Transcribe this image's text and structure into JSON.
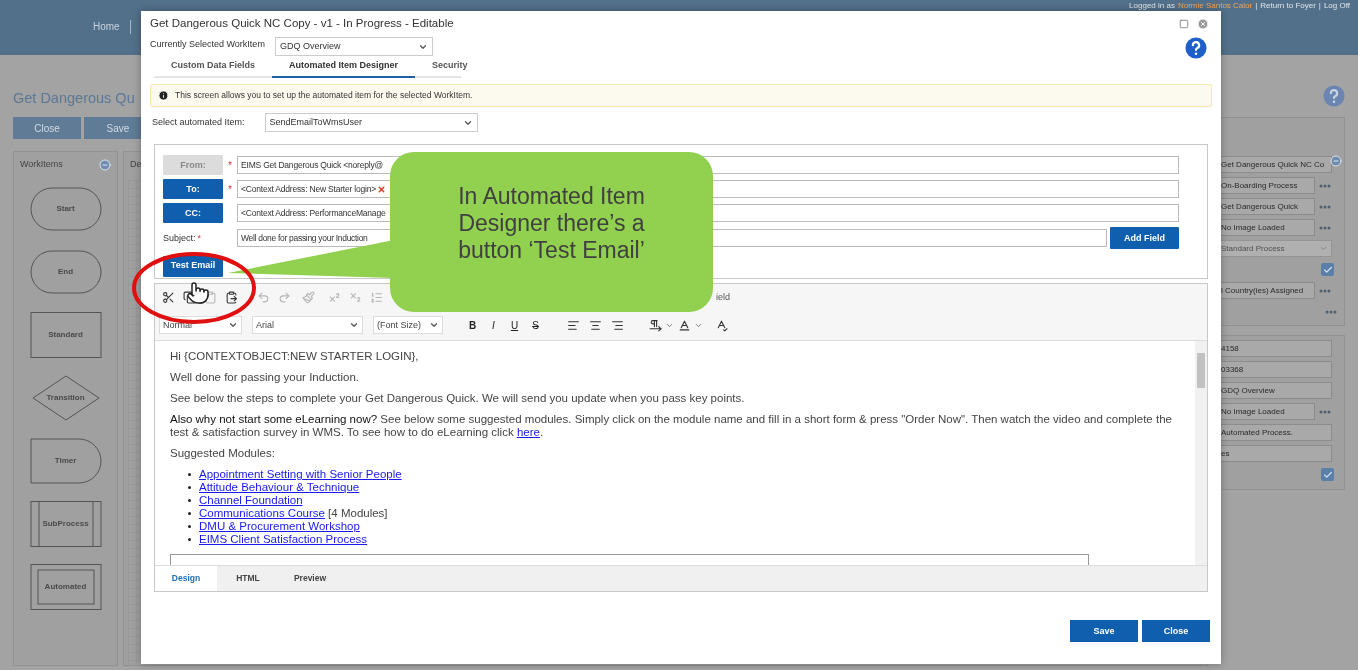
{
  "app_header": {
    "nav": [
      "Home"
    ],
    "user": {
      "prefix": "Logged in as",
      "name": "Normie Santos Calor",
      "separator": "|",
      "links": [
        "Return to Foyer",
        "Log Off"
      ]
    }
  },
  "page": {
    "title": "Get Dangerous Qu",
    "buttons": [
      "Close",
      "Save"
    ],
    "workitems_panel": {
      "title": "WorkItems",
      "items": [
        {
          "kind": "start",
          "label": "Start"
        },
        {
          "kind": "end",
          "label": "End"
        },
        {
          "kind": "standard",
          "label": "Standard"
        },
        {
          "kind": "transition",
          "label": "Transition"
        },
        {
          "kind": "timer",
          "label": "Timer"
        },
        {
          "kind": "subprocess",
          "label": "SubProcess"
        },
        {
          "kind": "automated",
          "label": "Automated"
        }
      ]
    },
    "designer_panel": {
      "title": "De"
    }
  },
  "properties": {
    "panels": [
      {
        "rows": [
          {
            "kind": "field",
            "value": "Get Dangerous Quick NC Co"
          },
          {
            "kind": "menu",
            "value": "On-Boarding Process"
          },
          {
            "kind": "menu",
            "value": "Get Dangerous Quick"
          },
          {
            "kind": "menu",
            "value": "No Image Loaded"
          },
          {
            "kind": "select",
            "value": "Standard Process"
          },
          {
            "kind": "checkbox",
            "checked": true
          },
          {
            "kind": "menu",
            "value": "l Country(ies) Assigned"
          },
          {
            "kind": "dots"
          }
        ]
      },
      {
        "rows": [
          {
            "kind": "field",
            "value": "4158"
          },
          {
            "kind": "field",
            "value": "03368"
          },
          {
            "kind": "field",
            "value": "GDQ Overview"
          },
          {
            "kind": "menu",
            "value": "No Image Loaded"
          },
          {
            "kind": "field",
            "value": "Automated Process."
          },
          {
            "kind": "field",
            "value": "es"
          },
          {
            "kind": "checkbox",
            "checked": true
          }
        ]
      }
    ]
  },
  "dialog": {
    "title": "Get Dangerous Quick NC Copy - v1 - In Progress - Editable",
    "workitem": {
      "label": "Currently Selected WorkItem",
      "value": "GDQ Overview"
    },
    "tabs": [
      {
        "label": "Custom Data Fields",
        "selected": false
      },
      {
        "label": "Automated Item Designer",
        "selected": true
      },
      {
        "label": "Security",
        "selected": false
      }
    ],
    "info": "This screen allows you to set up the automated item for the selected WorkItem.",
    "automated_item": {
      "label": "Select automated Item:",
      "value": "SendEmailToWmsUser"
    },
    "email": {
      "required_mark": "*",
      "rows": [
        {
          "button": "From:",
          "disabled": true,
          "required": true,
          "value": "EIMS Get Dangerous Quick <noreply@",
          "removable": false
        },
        {
          "button": "To:",
          "disabled": false,
          "required": true,
          "value": "<Context Address: New Starter login>",
          "removable": true
        },
        {
          "button": "CC:",
          "disabled": false,
          "required": false,
          "value": "<Context Address: PerformanceManage",
          "removable": false
        }
      ],
      "subject": {
        "label": "Subject:",
        "required": true,
        "value": "Well done for passing your Induction"
      },
      "add_field": "Add Field",
      "test_email": "Test Email"
    },
    "editor": {
      "toolbar_partial_text": "ield",
      "styles": [
        "Normal",
        "Arial",
        "(Font Size)"
      ],
      "format_buttons": [
        "B",
        "I",
        "U",
        "S"
      ],
      "content": {
        "greeting": "Hi {CONTEXTOBJECT:NEW STARTER LOGIN},",
        "paragraphs": [
          "Well done for passing your Induction.",
          "See below the steps to complete your Get Dangerous Quick. We will send you update when you pass key points."
        ],
        "elearning": {
          "lead": "Also why not start some eLearning now?",
          "text": " See below some suggested modules. Simply click on the module name and fill in a short form & press \"Order Now\". Then watch the video and complete the test & satisfaction survey in WMS. To see how to do eLearning click ",
          "link": "here",
          "end": "."
        },
        "modules_heading": "Suggested Modules:",
        "modules": [
          {
            "link": "Appointment Setting with Senior People"
          },
          {
            "link": "Attitude Behaviour & Technique"
          },
          {
            "link": "Channel Foundation"
          },
          {
            "link": "Communications Course",
            "suffix": " [4 Modules]"
          },
          {
            "link": "DMU & Procurement Workshop"
          },
          {
            "link": "EIMS Client Satisfaction Process"
          }
        ]
      },
      "tabs": [
        {
          "label": "Design",
          "selected": true
        },
        {
          "label": "HTML",
          "selected": false
        },
        {
          "label": "Preview",
          "selected": false
        }
      ]
    },
    "footer": [
      "Save",
      "Close"
    ]
  },
  "callout": {
    "text": "In Automated Item Designer there’s a button ‘Test Email’"
  }
}
